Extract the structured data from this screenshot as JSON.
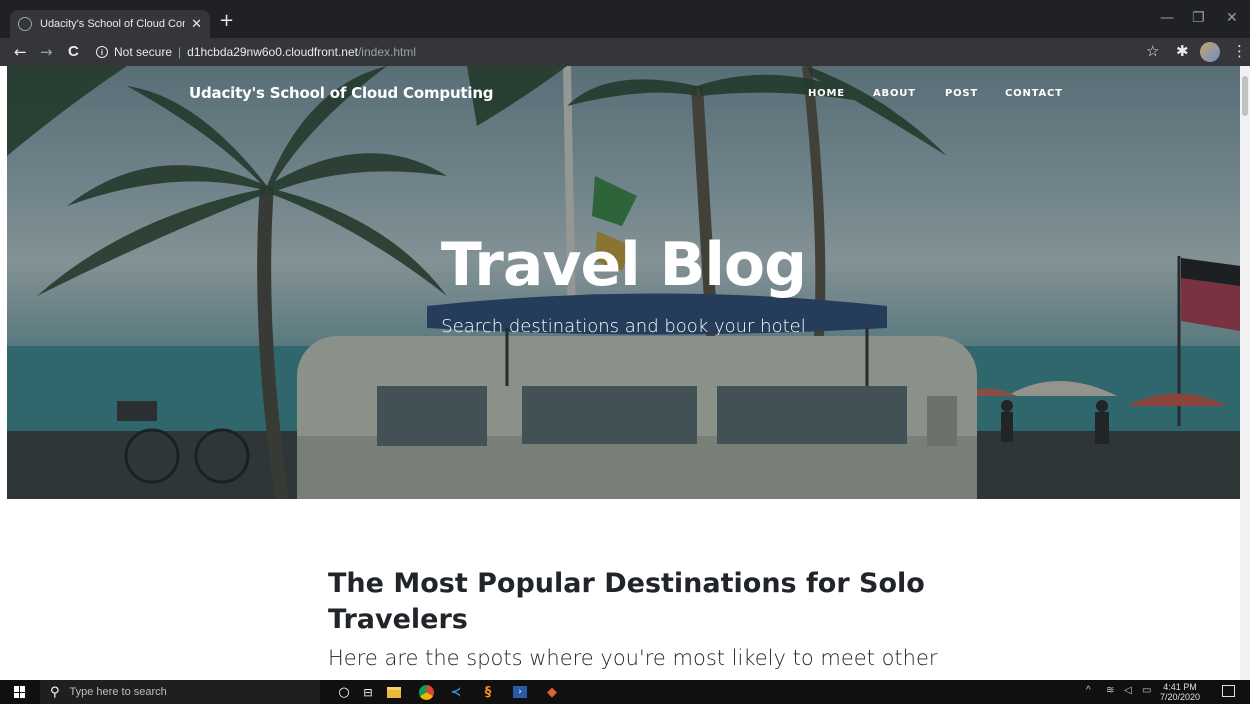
{
  "browser": {
    "tab_title": "Udacity's School of Cloud Comp",
    "tab_close": "✕",
    "new_tab": "+",
    "security_label": "Not secure",
    "url_host": "d1hcbda29nw6o0.cloudfront.net",
    "url_path": "/index.html",
    "win_minimize": "—",
    "win_restore": "❐",
    "win_close": "✕",
    "back": "←",
    "forward": "→",
    "reload": "C",
    "bookmark_star": "☆",
    "extensions": "✱",
    "menu": "⋮"
  },
  "site": {
    "brand": "Udacity's School of Cloud Computing",
    "nav": [
      "HOME",
      "ABOUT",
      "POST",
      "CONTACT"
    ],
    "hero_title": "Travel Blog",
    "hero_subtitle": "Search destinations and book your hotel",
    "post_title": "The Most Popular Destinations for Solo Travelers",
    "post_subtitle": "Here are the spots where you're most likely to meet other"
  },
  "taskbar": {
    "search_placeholder": "Type here to search",
    "time": "4:41 PM",
    "date": "7/20/2020"
  },
  "icons": [
    "windows-icon",
    "search-icon",
    "cortana-icon",
    "task-view-icon",
    "file-explorer-icon",
    "chrome-icon",
    "vscode-icon",
    "sublime-icon",
    "powershell-icon",
    "git-icon",
    "chevron-up-icon",
    "wifi-icon",
    "volume-icon",
    "battery-icon",
    "notification-icon"
  ]
}
